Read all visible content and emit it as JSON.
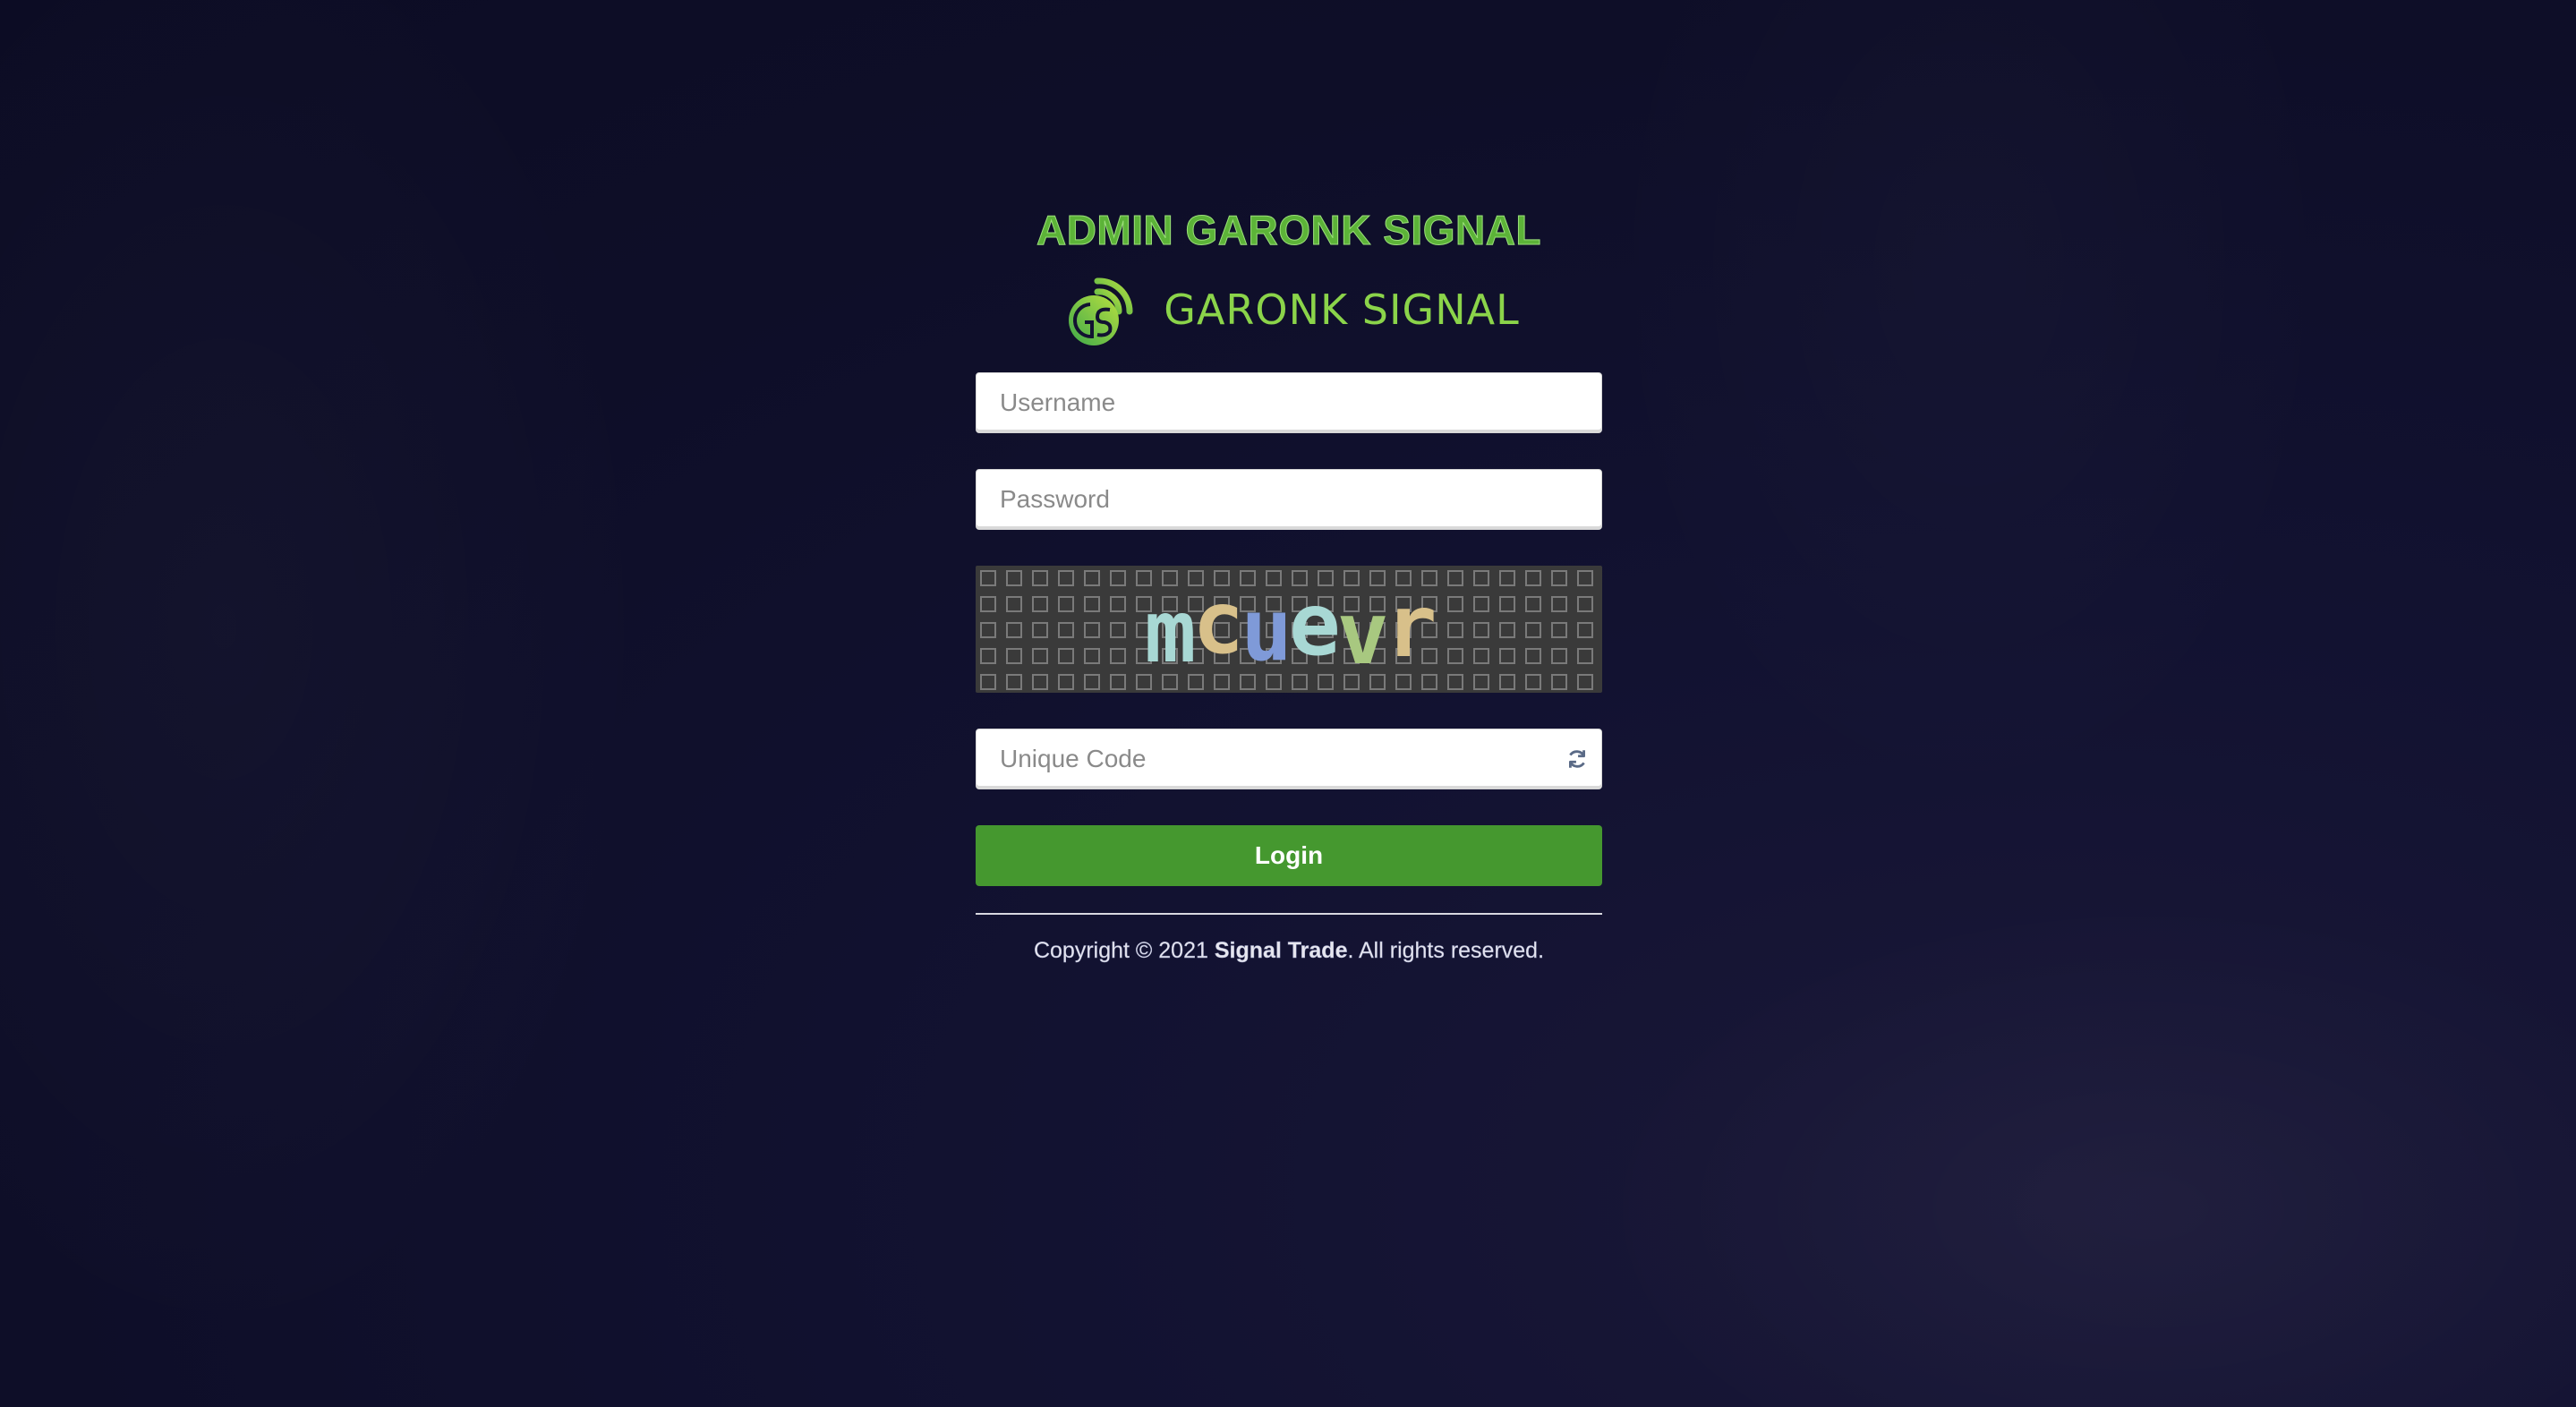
{
  "header": {
    "admin_title": "ADMIN GARONK SIGNAL",
    "logo_text": "GARONK SIGNAL",
    "logo_monogram": "GS"
  },
  "form": {
    "username_placeholder": "Username",
    "password_placeholder": "Password",
    "captcha_chars": [
      "m",
      "c",
      "u",
      "e",
      "v",
      "r"
    ],
    "captcha_colors": [
      "#a8d8d4",
      "#d8c08a",
      "#7f9ad8",
      "#a8d8d4",
      "#a8c880",
      "#d8c08a"
    ],
    "unique_code_placeholder": "Unique Code",
    "refresh_icon": "refresh-icon",
    "login_label": "Login"
  },
  "footer": {
    "copyright_prefix": "Copyright © 2021 ",
    "brand": "Signal Trade",
    "copyright_suffix": ". All rights reserved."
  },
  "colors": {
    "background": "#0e0e28",
    "accent_green": "#45982f",
    "title_green": "#5cb338",
    "logo_green": "#8bd44a"
  }
}
